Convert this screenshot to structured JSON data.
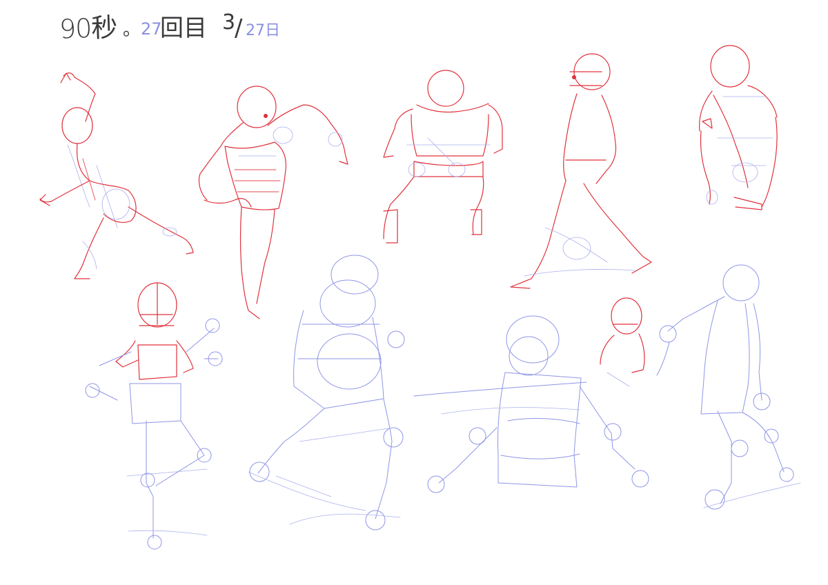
{
  "header": {
    "seconds": "90秒",
    "dot": "。",
    "count": "27",
    "kai": "回目",
    "month": "3",
    "slash": "/",
    "day": "27日"
  },
  "colors": {
    "red_ink": "#e0303a",
    "blue_ink": "#8d95e6",
    "dark_ink": "#3a3a3a",
    "paper": "#ffffff"
  }
}
